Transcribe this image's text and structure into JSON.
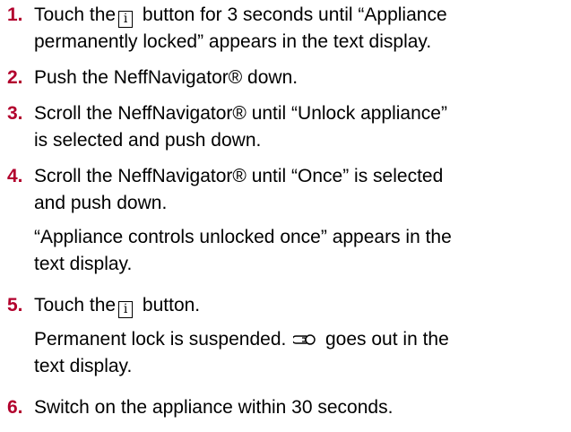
{
  "steps": [
    {
      "number": "1.",
      "lines": [
        "Touch the",
        "button for 3 seconds until “Appliance",
        "permanently locked” appears in the text display."
      ],
      "icon": "info-button-icon",
      "icon_glyph": "i"
    },
    {
      "number": "2.",
      "lines": [
        "Push the NeffNavigator® down."
      ]
    },
    {
      "number": "3.",
      "lines": [
        "Scroll the NeffNavigator® until “Unlock appliance”",
        "is selected and push down."
      ]
    },
    {
      "number": "4.",
      "lines": [
        "Scroll the NeffNavigator® until “Once” is selected",
        "and push down."
      ],
      "result": [
        "“Appliance controls unlocked once” appears in the",
        "text display."
      ]
    },
    {
      "number": "5.",
      "lines": [
        "Touch the",
        "button."
      ],
      "icon": "info-button-icon",
      "icon_glyph": "i",
      "result": [
        "Permanent lock is suspended.",
        "goes out in the",
        "text display."
      ],
      "result_icon": "key-lock-icon"
    },
    {
      "number": "6.",
      "lines": [
        "Switch on the appliance within 30 seconds."
      ]
    }
  ],
  "colors": {
    "step_number": "#b2002d",
    "text": "#000000"
  }
}
